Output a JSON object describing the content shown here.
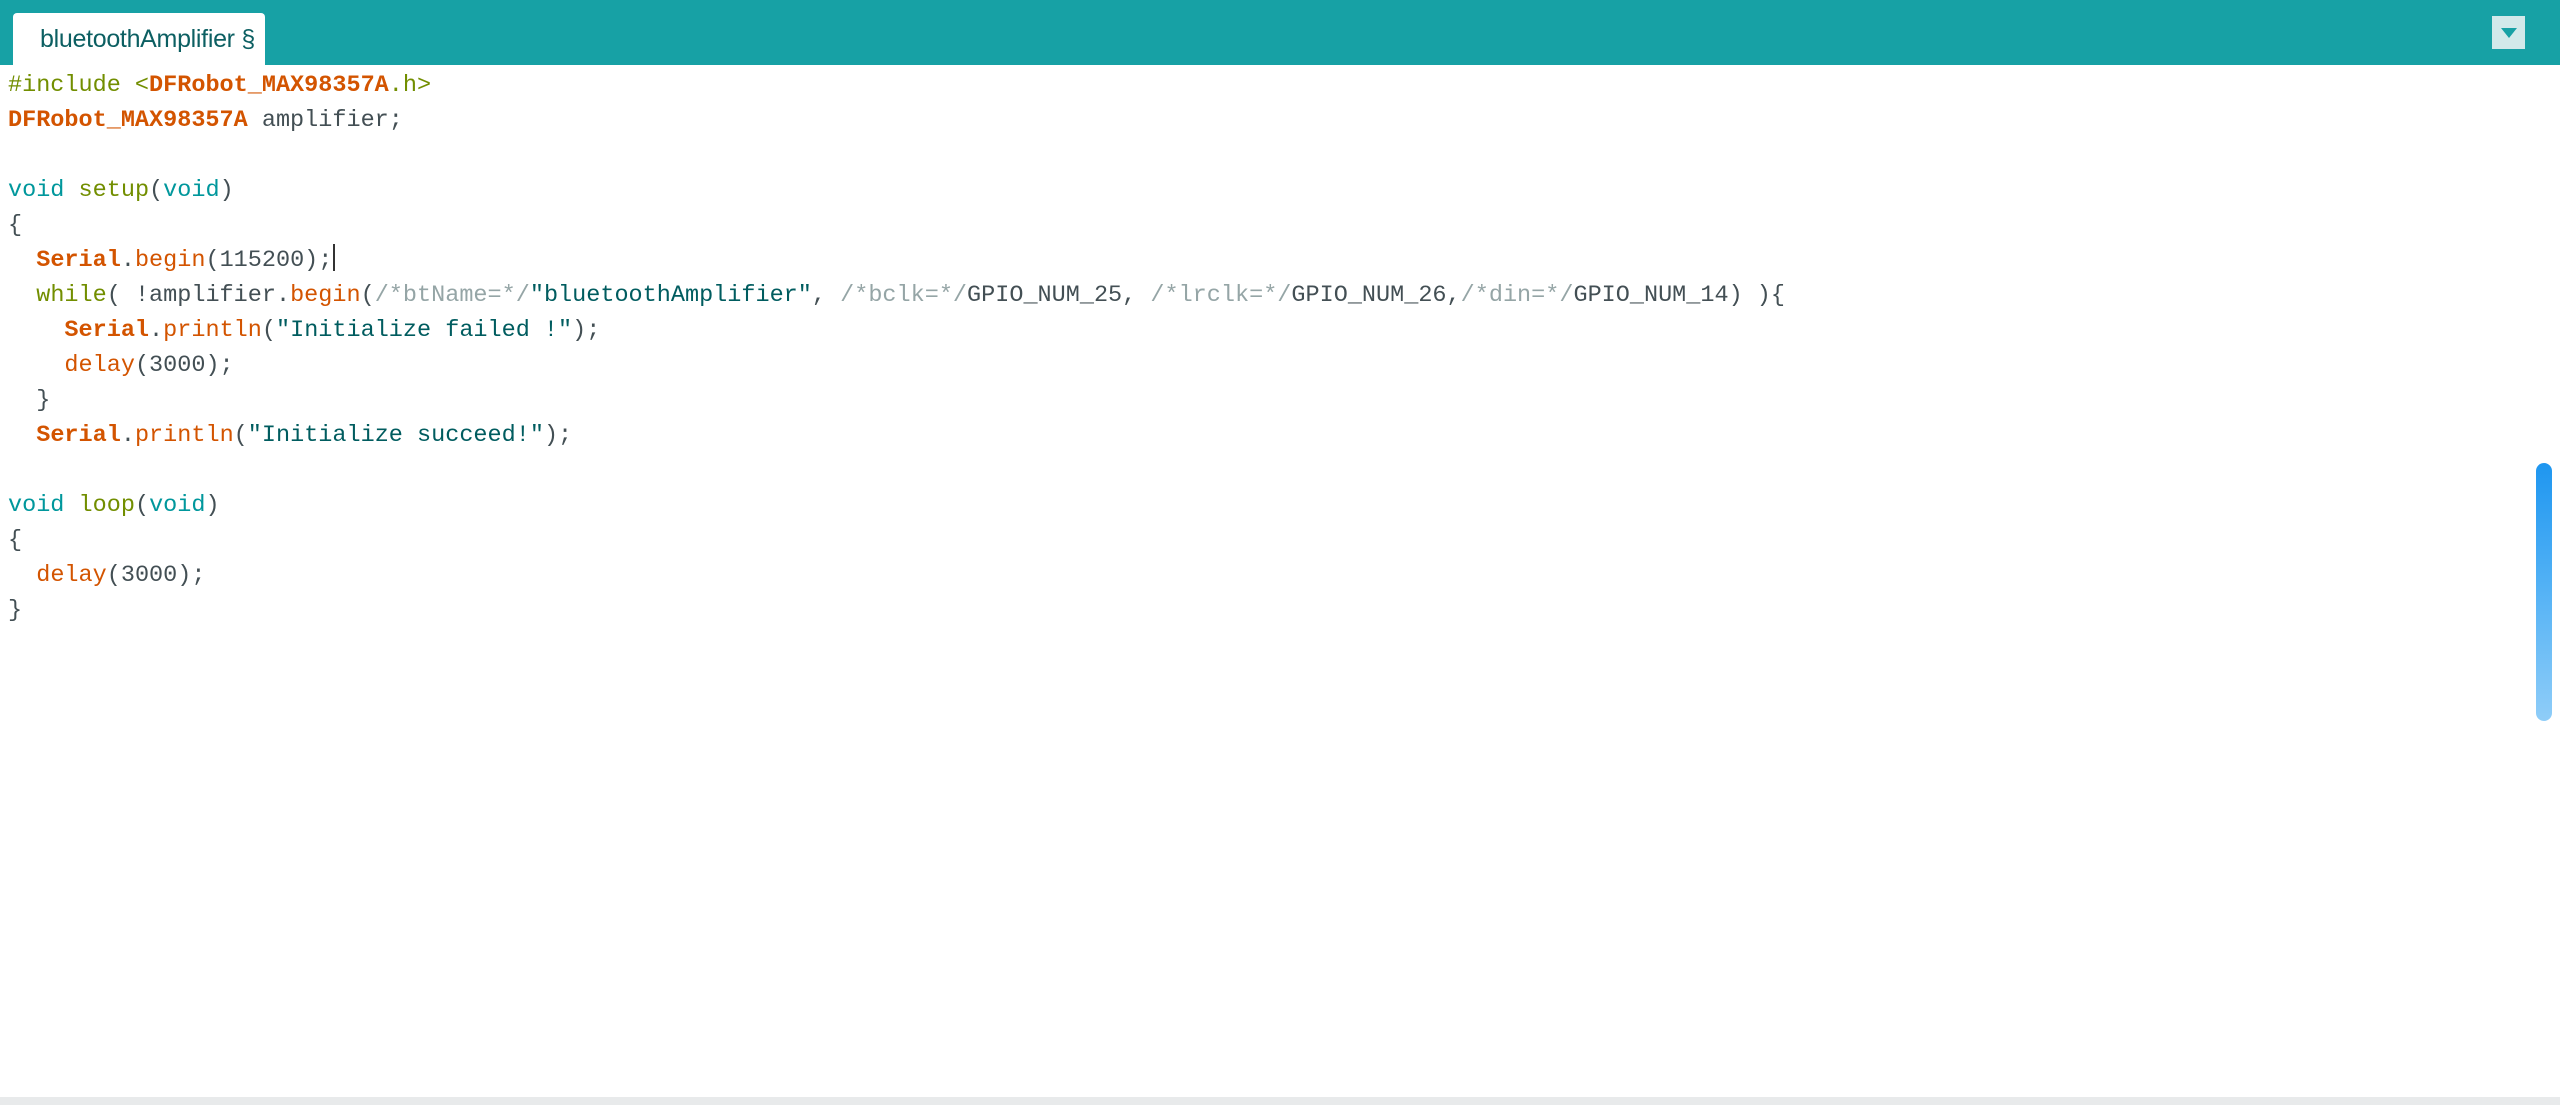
{
  "tab": {
    "label": "bluetoothAmplifier §",
    "menu_icon": "triangle-down-icon"
  },
  "colors": {
    "tabbar": "#17a1a5",
    "keyword": "#728e00",
    "type": "#00979c",
    "class": "#d35400",
    "comment": "#95a5a6",
    "string": "#005c5f",
    "scroll_thumb": "#1e96f0"
  },
  "editor": {
    "lines": [
      [
        {
          "t": "kw",
          "v": "#include "
        },
        {
          "t": "kw",
          "v": "<"
        },
        {
          "t": "cls",
          "v": "DFRobot_MAX98357A"
        },
        {
          "t": "kw",
          "v": ".h>"
        }
      ],
      [
        {
          "t": "cls",
          "v": "DFRobot_MAX98357A"
        },
        {
          "t": "p",
          "v": " amplifier;"
        }
      ],
      [],
      [
        {
          "t": "type",
          "v": "void"
        },
        {
          "t": "p",
          "v": " "
        },
        {
          "t": "kw",
          "v": "setup"
        },
        {
          "t": "p",
          "v": "("
        },
        {
          "t": "type",
          "v": "void"
        },
        {
          "t": "p",
          "v": ")"
        }
      ],
      [
        {
          "t": "p",
          "v": "{"
        }
      ],
      [
        {
          "t": "p",
          "v": "  "
        },
        {
          "t": "cls",
          "v": "Serial"
        },
        {
          "t": "p",
          "v": "."
        },
        {
          "t": "fn",
          "v": "begin"
        },
        {
          "t": "p",
          "v": "(115200);"
        },
        {
          "t": "caret",
          "v": ""
        }
      ],
      [
        {
          "t": "p",
          "v": "  "
        },
        {
          "t": "kw",
          "v": "while"
        },
        {
          "t": "p",
          "v": "( !amplifier."
        },
        {
          "t": "fn",
          "v": "begin"
        },
        {
          "t": "p",
          "v": "("
        },
        {
          "t": "cm",
          "v": "/*btName=*/"
        },
        {
          "t": "str",
          "v": "\"bluetoothAmplifier\""
        },
        {
          "t": "p",
          "v": ", "
        },
        {
          "t": "cm",
          "v": "/*bclk=*/"
        },
        {
          "t": "p",
          "v": "GPIO_NUM_25, "
        },
        {
          "t": "cm",
          "v": "/*lrclk=*/"
        },
        {
          "t": "p",
          "v": "GPIO_NUM_26,"
        },
        {
          "t": "cm",
          "v": "/*din=*/"
        },
        {
          "t": "p",
          "v": "GPIO_NUM_14) ){"
        }
      ],
      [
        {
          "t": "p",
          "v": "    "
        },
        {
          "t": "cls",
          "v": "Serial"
        },
        {
          "t": "p",
          "v": "."
        },
        {
          "t": "fn",
          "v": "println"
        },
        {
          "t": "p",
          "v": "("
        },
        {
          "t": "str",
          "v": "\"Initialize failed !\""
        },
        {
          "t": "p",
          "v": ");"
        }
      ],
      [
        {
          "t": "p",
          "v": "    "
        },
        {
          "t": "fn",
          "v": "delay"
        },
        {
          "t": "p",
          "v": "(3000);"
        }
      ],
      [
        {
          "t": "p",
          "v": "  }"
        }
      ],
      [
        {
          "t": "p",
          "v": "  "
        },
        {
          "t": "cls",
          "v": "Serial"
        },
        {
          "t": "p",
          "v": "."
        },
        {
          "t": "fn",
          "v": "println"
        },
        {
          "t": "p",
          "v": "("
        },
        {
          "t": "str",
          "v": "\"Initialize succeed!\""
        },
        {
          "t": "p",
          "v": ");"
        }
      ],
      [],
      [
        {
          "t": "type",
          "v": "void"
        },
        {
          "t": "p",
          "v": " "
        },
        {
          "t": "kw",
          "v": "loop"
        },
        {
          "t": "p",
          "v": "("
        },
        {
          "t": "type",
          "v": "void"
        },
        {
          "t": "p",
          "v": ")"
        }
      ],
      [
        {
          "t": "p",
          "v": "{"
        }
      ],
      [
        {
          "t": "p",
          "v": "  "
        },
        {
          "t": "fn",
          "v": "delay"
        },
        {
          "t": "p",
          "v": "(3000);"
        }
      ],
      [
        {
          "t": "p",
          "v": "}"
        }
      ]
    ]
  }
}
